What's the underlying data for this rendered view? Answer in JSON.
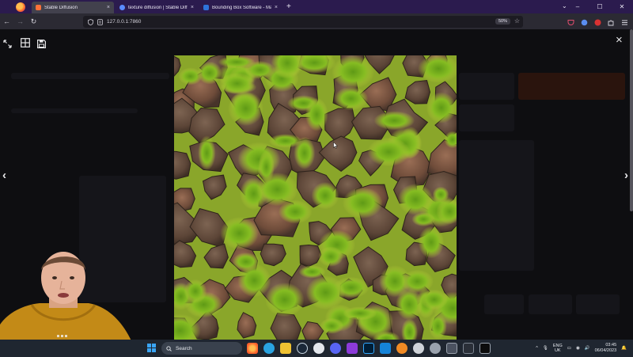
{
  "browser": {
    "tabs": [
      {
        "title": "Stable Diffusion",
        "active": true,
        "favicon_color": "#ff7139"
      },
      {
        "title": "texture diffusion | Stable Diffu",
        "active": false,
        "favicon_color": "#5a8cff"
      },
      {
        "title": "Bounding Box Software - Mate",
        "active": false,
        "favicon_color": "#2e74d9"
      }
    ],
    "tab_close_glyph": "×",
    "new_tab_glyph": "+",
    "url": "127.0.0.1:7860",
    "zoom": "50%"
  },
  "lightbox": {
    "close_glyph": "×",
    "prev_glyph": "‹",
    "next_glyph": "›"
  },
  "taskbar": {
    "search_label": "Search",
    "language_top": "ENG",
    "language_bottom": "UK",
    "time": "03:45",
    "date": "06/04/2023",
    "apps": [
      "firefox-icon",
      "telegram-icon",
      "file-explorer-icon",
      "steam-icon",
      "app-icon",
      "discord-icon",
      "affinity-icon",
      "photoshop-icon",
      "mail-icon",
      "blender-icon",
      "unity-icon",
      "settings-icon",
      "monitor-icon",
      "app-icon",
      "terminal-icon"
    ]
  },
  "colors": {
    "accent": "#2b1b4e",
    "moss": "#7fb21f",
    "rock": "#6b4f3f"
  }
}
